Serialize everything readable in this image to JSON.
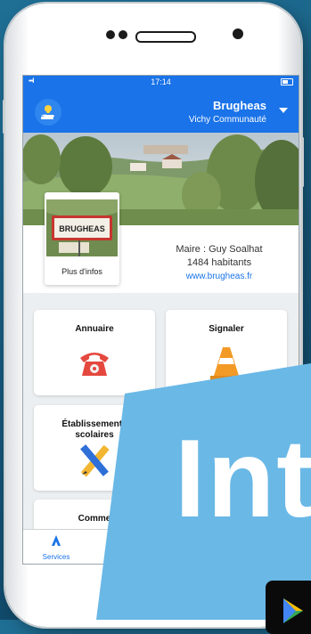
{
  "status_bar": {
    "time": "17:14",
    "signal": "•••ll"
  },
  "header": {
    "city": "Brugheas",
    "community": "Vichy Communauté"
  },
  "info": {
    "more_button": "Plus d'infos",
    "sign_text": "BRUGHEAS",
    "mayor": "Maire : Guy Soalhat",
    "population": "1484 habitants",
    "website": "www.brugheas.fr"
  },
  "tiles": [
    {
      "title": "Annuaire",
      "icon": "telephone-icon"
    },
    {
      "title": "Signaler",
      "icon": "traffic-cone-icon"
    },
    {
      "title": "Établissements scolaires",
      "title_line1": "Établissements",
      "title_line2": "scolaires",
      "icon": "pencil-ruler-icon"
    },
    {
      "title": "Comme",
      "icon": ""
    }
  ],
  "bottom_nav": {
    "services_label": "Services"
  },
  "overlay": {
    "text": "Int"
  },
  "colors": {
    "brand_blue": "#1a73e8",
    "overlay_blue": "#6ab8e6",
    "background": "#17597c"
  }
}
